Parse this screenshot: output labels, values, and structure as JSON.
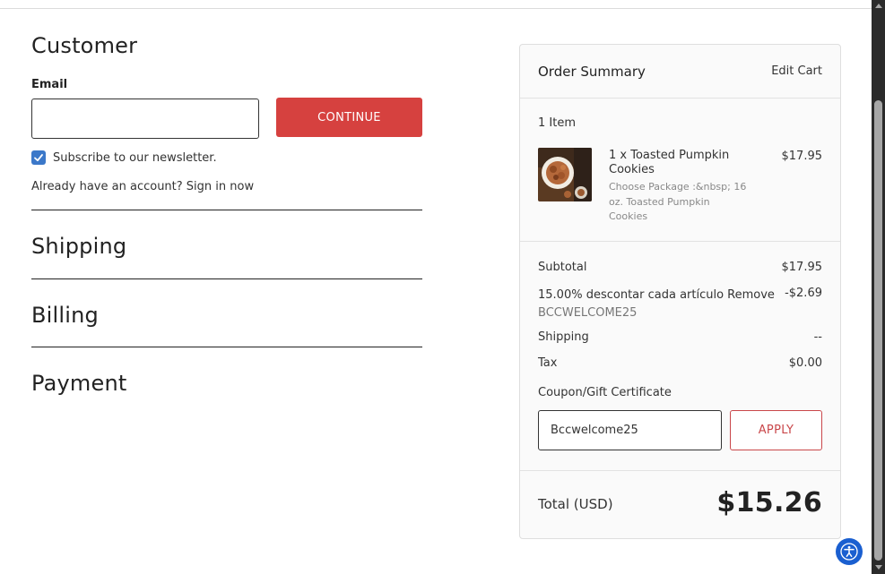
{
  "checkout": {
    "customer_heading": "Customer",
    "email_label": "Email",
    "email_value": "",
    "continue_label": "CONTINUE",
    "newsletter_label": "Subscribe to our newsletter.",
    "newsletter_checked": true,
    "signin_text": "Already have an account? Sign in now",
    "shipping_heading": "Shipping",
    "billing_heading": "Billing",
    "payment_heading": "Payment"
  },
  "summary": {
    "title": "Order Summary",
    "edit_cart": "Edit Cart",
    "items_count": "1 Item",
    "item": {
      "name": "1 x Toasted Pumpkin Cookies",
      "price": "$17.95",
      "options": "Choose Package :&nbsp; 16 oz. Toasted Pumpkin Cookies",
      "thumbnail_icon": "cookie-product-image"
    },
    "subtotal_label": "Subtotal",
    "subtotal_value": "$17.95",
    "discount_label": "15.00% descontar cada artículo Remove",
    "discount_code": "BCCWELCOME25",
    "discount_value": "-$2.69",
    "shipping_label": "Shipping",
    "shipping_value": "--",
    "tax_label": "Tax",
    "tax_value": "$0.00",
    "coupon_label": "Coupon/Gift Certificate",
    "coupon_value": "Bccwelcome25",
    "apply_label": "APPLY",
    "total_label": "Total (USD)",
    "total_value": "$15.26"
  },
  "colors": {
    "accent_red": "#d6413f",
    "checkbox_blue": "#3b78c9",
    "accessibility_blue": "#1a5fd0"
  },
  "icons": {
    "checkbox": "checkmark-icon",
    "accessibility": "accessibility-icon"
  }
}
